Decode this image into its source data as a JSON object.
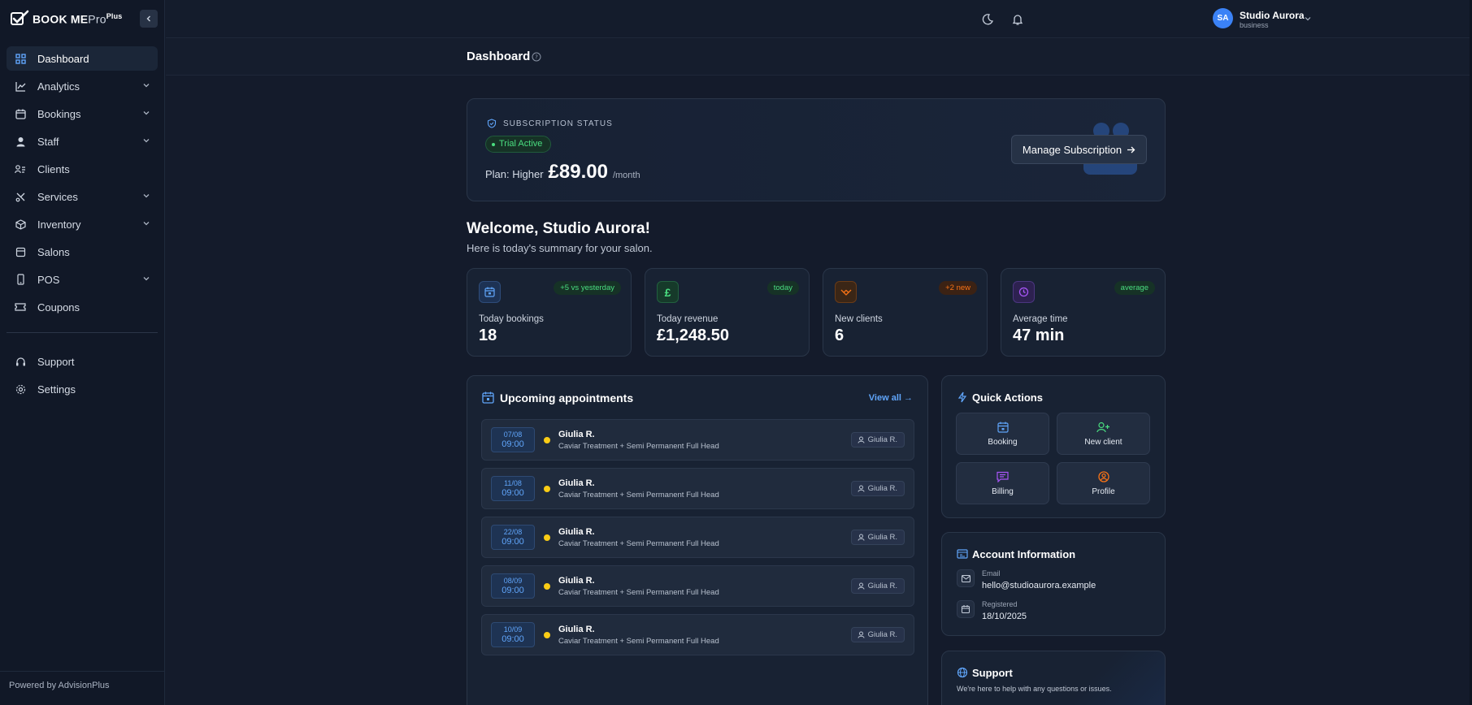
{
  "app": {
    "logo_text": "BOOK ME",
    "logo_pro": "Pro",
    "logo_plus": "Plus",
    "powered_by": "Powered by AdvisionPlus"
  },
  "sidebar": {
    "items": [
      {
        "label": "Dashboard",
        "icon": "grid-icon"
      },
      {
        "label": "Analytics",
        "icon": "chart-line-icon"
      },
      {
        "label": "Bookings",
        "icon": "calendar-icon"
      },
      {
        "label": "Staff",
        "icon": "user-icon"
      },
      {
        "label": "Clients",
        "icon": "contacts-icon"
      },
      {
        "label": "Services",
        "icon": "scissors-icon"
      },
      {
        "label": "Inventory",
        "icon": "box-icon"
      },
      {
        "label": "Salons",
        "icon": "store-icon"
      },
      {
        "label": "POS",
        "icon": "phone-icon"
      },
      {
        "label": "Coupons",
        "icon": "ticket-icon"
      }
    ],
    "bottom_items": [
      {
        "label": "Support",
        "icon": "headset-icon"
      },
      {
        "label": "Settings",
        "icon": "gear-icon"
      }
    ]
  },
  "header": {
    "user_initials": "SA",
    "user_name": "Studio Aurora",
    "user_role": "business",
    "page_title": "Dashboard"
  },
  "subscription": {
    "label": "SUBSCRIPTION STATUS",
    "status": "Trial Active",
    "plan_label": "Plan: Higher",
    "price": "£89.00",
    "period": "/month",
    "manage_label": "Manage Subscription"
  },
  "welcome": {
    "title": "Welcome, Studio Aurora!",
    "subtitle": "Here is today's summary for your salon."
  },
  "stats": [
    {
      "label": "Today bookings",
      "value": "18",
      "badge": "+5 vs yesterday",
      "icon": "calendar-icon"
    },
    {
      "label": "Today revenue",
      "value": "£1,248.50",
      "badge": "today",
      "icon": "pound-icon"
    },
    {
      "label": "New clients",
      "value": "6",
      "badge": "+2 new",
      "icon": "handshake-icon"
    },
    {
      "label": "Average time",
      "value": "47 min",
      "badge": "average",
      "icon": "clock-icon"
    }
  ],
  "appointments": {
    "title": "Upcoming appointments",
    "view_all": "View all →",
    "rows": [
      {
        "date": "07/08",
        "time": "09:00",
        "client": "Giulia R.",
        "service": "Caviar Treatment + Semi Permanent Full Head",
        "staff": "Giulia R."
      },
      {
        "date": "11/08",
        "time": "09:00",
        "client": "Giulia R.",
        "service": "Caviar Treatment + Semi Permanent Full Head",
        "staff": "Giulia R."
      },
      {
        "date": "22/08",
        "time": "09:00",
        "client": "Giulia R.",
        "service": "Caviar Treatment + Semi Permanent Full Head",
        "staff": "Giulia R."
      },
      {
        "date": "08/09",
        "time": "09:00",
        "client": "Giulia R.",
        "service": "Caviar Treatment + Semi Permanent Full Head",
        "staff": "Giulia R."
      },
      {
        "date": "10/09",
        "time": "09:00",
        "client": "Giulia R.",
        "service": "Caviar Treatment + Semi Permanent Full Head",
        "staff": "Giulia R."
      }
    ]
  },
  "quick_actions": {
    "title": "Quick Actions",
    "items": [
      {
        "label": "Booking",
        "icon": "calendar-icon"
      },
      {
        "label": "New client",
        "icon": "user-plus-icon"
      },
      {
        "label": "Billing",
        "icon": "message-icon"
      },
      {
        "label": "Profile",
        "icon": "user-circle-icon"
      }
    ]
  },
  "account": {
    "title": "Account Information",
    "email_label": "Email",
    "email": "hello@studioaurora.example",
    "registered_label": "Registered",
    "registered": "18/10/2025"
  },
  "support": {
    "title": "Support",
    "text": "We're here to help with any questions or issues."
  },
  "colors": {
    "accent": "#3b82f6",
    "success": "#4ade80",
    "warning": "#facc15",
    "orange": "#f97316",
    "purple": "#a855f7"
  }
}
